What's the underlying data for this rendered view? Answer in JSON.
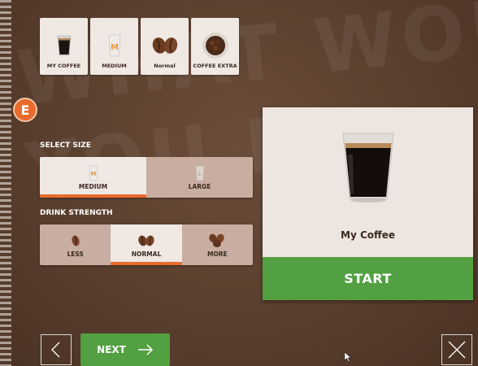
{
  "top_tiles": [
    {
      "label": "MY COFFEE",
      "icon": "cup-icon"
    },
    {
      "label": "MEDIUM",
      "icon": "medium-glass-icon"
    },
    {
      "label": "Normal",
      "icon": "two-beans-icon"
    },
    {
      "label": "COFFEE EXTRA",
      "icon": "beans-bowl-icon"
    }
  ],
  "badge": "E",
  "size": {
    "label": "SELECT SIZE",
    "options": [
      "MEDIUM",
      "LARGE"
    ],
    "selected": "MEDIUM"
  },
  "strength": {
    "label": "DRINK STRENGTH",
    "options": [
      "LESS",
      "NORMAL",
      "MORE"
    ],
    "selected": "NORMAL"
  },
  "card": {
    "drink_name": "My Coffee",
    "start_label": "START"
  },
  "nav": {
    "next_label": "NEXT"
  },
  "colors": {
    "accent": "#e86a2c",
    "primary": "#52a041"
  }
}
